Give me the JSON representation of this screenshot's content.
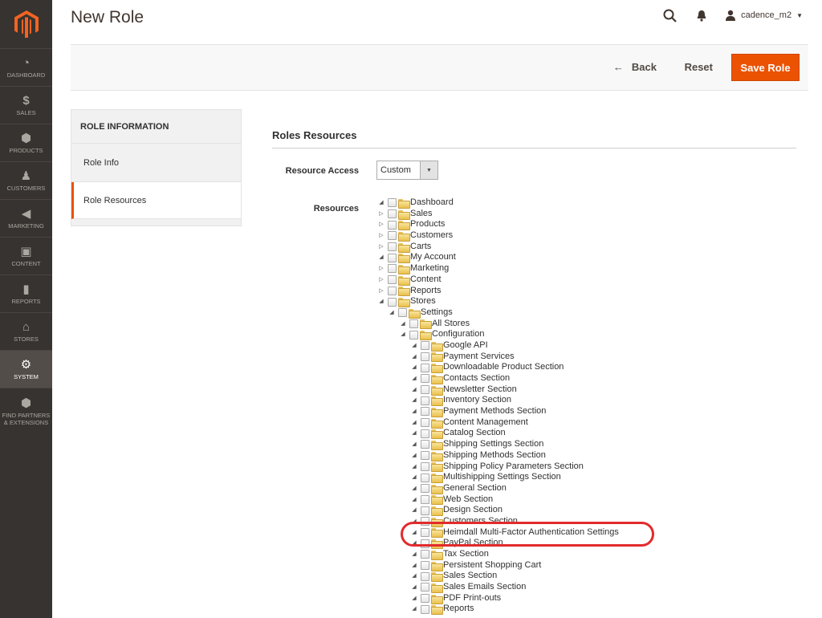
{
  "sidebar": {
    "logo_icon": "magento-logo-icon",
    "items": [
      {
        "label": "DASHBOARD",
        "icon": "dashboard-icon",
        "glyph": "◔"
      },
      {
        "label": "SALES",
        "icon": "dollar-icon",
        "glyph": "$"
      },
      {
        "label": "PRODUCTS",
        "icon": "box-icon",
        "glyph": "⬢"
      },
      {
        "label": "CUSTOMERS",
        "icon": "person-icon",
        "glyph": "♟"
      },
      {
        "label": "MARKETING",
        "icon": "megaphone-icon",
        "glyph": "◀"
      },
      {
        "label": "CONTENT",
        "icon": "layout-icon",
        "glyph": "▣"
      },
      {
        "label": "REPORTS",
        "icon": "bar-chart-icon",
        "glyph": "▮"
      },
      {
        "label": "STORES",
        "icon": "store-icon",
        "glyph": "⌂"
      },
      {
        "label": "SYSTEM",
        "icon": "gear-icon",
        "glyph": "⚙"
      },
      {
        "label": "FIND PARTNERS & EXTENSIONS",
        "icon": "cube-icon",
        "glyph": "⬢"
      }
    ],
    "active": "SYSTEM"
  },
  "header": {
    "title": "New Role",
    "username": "cadence_m2"
  },
  "actions": {
    "back": "Back",
    "reset": "Reset",
    "save": "Save Role"
  },
  "tabs": {
    "title": "ROLE INFORMATION",
    "items": [
      "Role Info",
      "Role Resources"
    ],
    "active": "Role Resources"
  },
  "main": {
    "section_title": "Roles Resources",
    "resource_access_label": "Resource Access",
    "resource_access_value": "Custom",
    "resources_label": "Resources"
  },
  "tree": [
    {
      "label": "Dashboard",
      "level": 0,
      "toggle": "open"
    },
    {
      "label": "Sales",
      "level": 0,
      "toggle": "closed"
    },
    {
      "label": "Products",
      "level": 0,
      "toggle": "closed"
    },
    {
      "label": "Customers",
      "level": 0,
      "toggle": "closed"
    },
    {
      "label": "Carts",
      "level": 0,
      "toggle": "closed"
    },
    {
      "label": "My Account",
      "level": 0,
      "toggle": "open"
    },
    {
      "label": "Marketing",
      "level": 0,
      "toggle": "closed"
    },
    {
      "label": "Content",
      "level": 0,
      "toggle": "closed"
    },
    {
      "label": "Reports",
      "level": 0,
      "toggle": "closed"
    },
    {
      "label": "Stores",
      "level": 0,
      "toggle": "open"
    },
    {
      "label": "Settings",
      "level": 1,
      "toggle": "open"
    },
    {
      "label": "All Stores",
      "level": 2,
      "toggle": "open"
    },
    {
      "label": "Configuration",
      "level": 2,
      "toggle": "open"
    },
    {
      "label": "Google API",
      "level": 3,
      "toggle": "open"
    },
    {
      "label": "Payment Services",
      "level": 3,
      "toggle": "open"
    },
    {
      "label": "Downloadable Product Section",
      "level": 3,
      "toggle": "open"
    },
    {
      "label": "Contacts Section",
      "level": 3,
      "toggle": "open"
    },
    {
      "label": "Newsletter Section",
      "level": 3,
      "toggle": "open"
    },
    {
      "label": "Inventory Section",
      "level": 3,
      "toggle": "open"
    },
    {
      "label": "Payment Methods Section",
      "level": 3,
      "toggle": "open"
    },
    {
      "label": "Content Management",
      "level": 3,
      "toggle": "open"
    },
    {
      "label": "Catalog Section",
      "level": 3,
      "toggle": "open"
    },
    {
      "label": "Shipping Settings Section",
      "level": 3,
      "toggle": "open"
    },
    {
      "label": "Shipping Methods Section",
      "level": 3,
      "toggle": "open"
    },
    {
      "label": "Shipping Policy Parameters Section",
      "level": 3,
      "toggle": "open"
    },
    {
      "label": "Multishipping Settings Section",
      "level": 3,
      "toggle": "open"
    },
    {
      "label": "General Section",
      "level": 3,
      "toggle": "open"
    },
    {
      "label": "Web Section",
      "level": 3,
      "toggle": "open"
    },
    {
      "label": "Design Section",
      "level": 3,
      "toggle": "open"
    },
    {
      "label": "Customers Section",
      "level": 3,
      "toggle": "open"
    },
    {
      "label": "Heimdall Multi-Factor Authentication Settings",
      "level": 3,
      "toggle": "open"
    },
    {
      "label": "PayPal Section",
      "level": 3,
      "toggle": "open"
    },
    {
      "label": "Tax Section",
      "level": 3,
      "toggle": "open"
    },
    {
      "label": "Persistent Shopping Cart",
      "level": 3,
      "toggle": "open"
    },
    {
      "label": "Sales Section",
      "level": 3,
      "toggle": "open"
    },
    {
      "label": "Sales Emails Section",
      "level": 3,
      "toggle": "open"
    },
    {
      "label": "PDF Print-outs",
      "level": 3,
      "toggle": "open"
    },
    {
      "label": "Reports",
      "level": 3,
      "toggle": "open"
    }
  ],
  "colors": {
    "accent": "#eb5202",
    "sidebar_bg": "#373330",
    "highlight_ring": "#e22b2b"
  }
}
